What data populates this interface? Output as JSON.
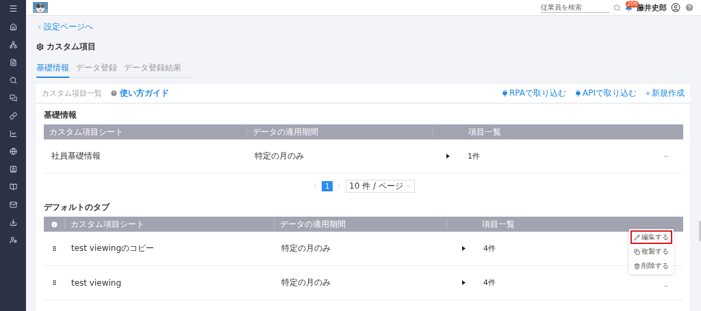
{
  "header": {
    "search": {
      "placeholder": "従業員を検索"
    },
    "notification_count": "206",
    "user_name": "藤井史郎"
  },
  "back_link": "設定ページへ",
  "page_title": "カスタム項目",
  "tabs": [
    {
      "label": "基礎情報",
      "selected": true
    },
    {
      "label": "データ登録",
      "selected": false
    },
    {
      "label": "データ登録結果",
      "selected": false
    }
  ],
  "card": {
    "title": "カスタム項目一覧",
    "guide_link": "使い方ガイド",
    "actions": [
      {
        "kind": "plug",
        "label": "RPAで取り込む"
      },
      {
        "kind": "plug",
        "label": "APIで取り込む"
      },
      {
        "kind": "plus",
        "label": "新規作成"
      }
    ]
  },
  "basic_section": {
    "title": "基礎情報",
    "columns": [
      "カスタム項目シート",
      "データの適用期間",
      "項目一覧"
    ],
    "rows": [
      {
        "sheet": "社員基礎情報",
        "period": "特定の月のみ",
        "count": "1件",
        "menu": "···"
      }
    ],
    "pagination": {
      "pages": [
        {
          "label": "1",
          "selected": true
        }
      ],
      "page_size": "10 件 / ページ"
    }
  },
  "default_section": {
    "title": "デフォルトのタブ",
    "columns": [
      "カスタム項目シート",
      "データの適用期間",
      "項目一覧"
    ],
    "rows": [
      {
        "sheet": "test viewingのコピー",
        "period": "特定の月のみ",
        "count": "4件"
      },
      {
        "sheet": "test viewing",
        "period": "特定の月のみ",
        "count": "4件",
        "menu": "···"
      }
    ]
  },
  "context_menu": {
    "items": [
      {
        "kind": "edit",
        "label": "編集する",
        "highlighted": true
      },
      {
        "kind": "copy",
        "label": "複製する",
        "highlighted": false
      },
      {
        "kind": "delete",
        "label": "削除する",
        "highlighted": false
      }
    ]
  }
}
